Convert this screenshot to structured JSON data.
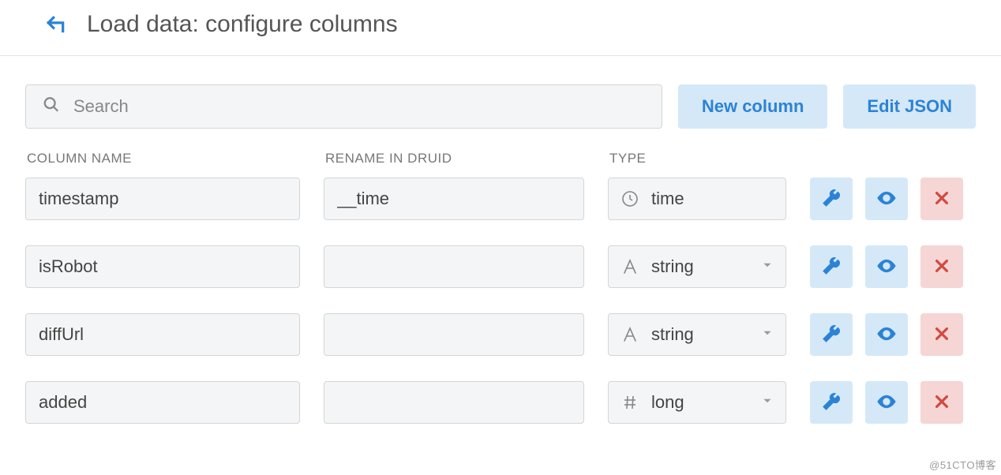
{
  "header": {
    "title": "Load data: configure columns"
  },
  "toolbar": {
    "search_placeholder": "Search",
    "new_column_label": "New column",
    "edit_json_label": "Edit JSON"
  },
  "column_headers": {
    "name": "COLUMN NAME",
    "rename": "RENAME IN DRUID",
    "type": "TYPE"
  },
  "rows": [
    {
      "name": "timestamp",
      "rename": "__time",
      "type_icon": "clock",
      "type_label": "time",
      "show_caret": false
    },
    {
      "name": "isRobot",
      "rename": "",
      "type_icon": "letter",
      "type_label": "string",
      "show_caret": true
    },
    {
      "name": "diffUrl",
      "rename": "",
      "type_icon": "letter",
      "type_label": "string",
      "show_caret": true
    },
    {
      "name": "added",
      "rename": "",
      "type_icon": "hash",
      "type_label": "long",
      "show_caret": true
    }
  ],
  "watermark": "@51CTO博客"
}
